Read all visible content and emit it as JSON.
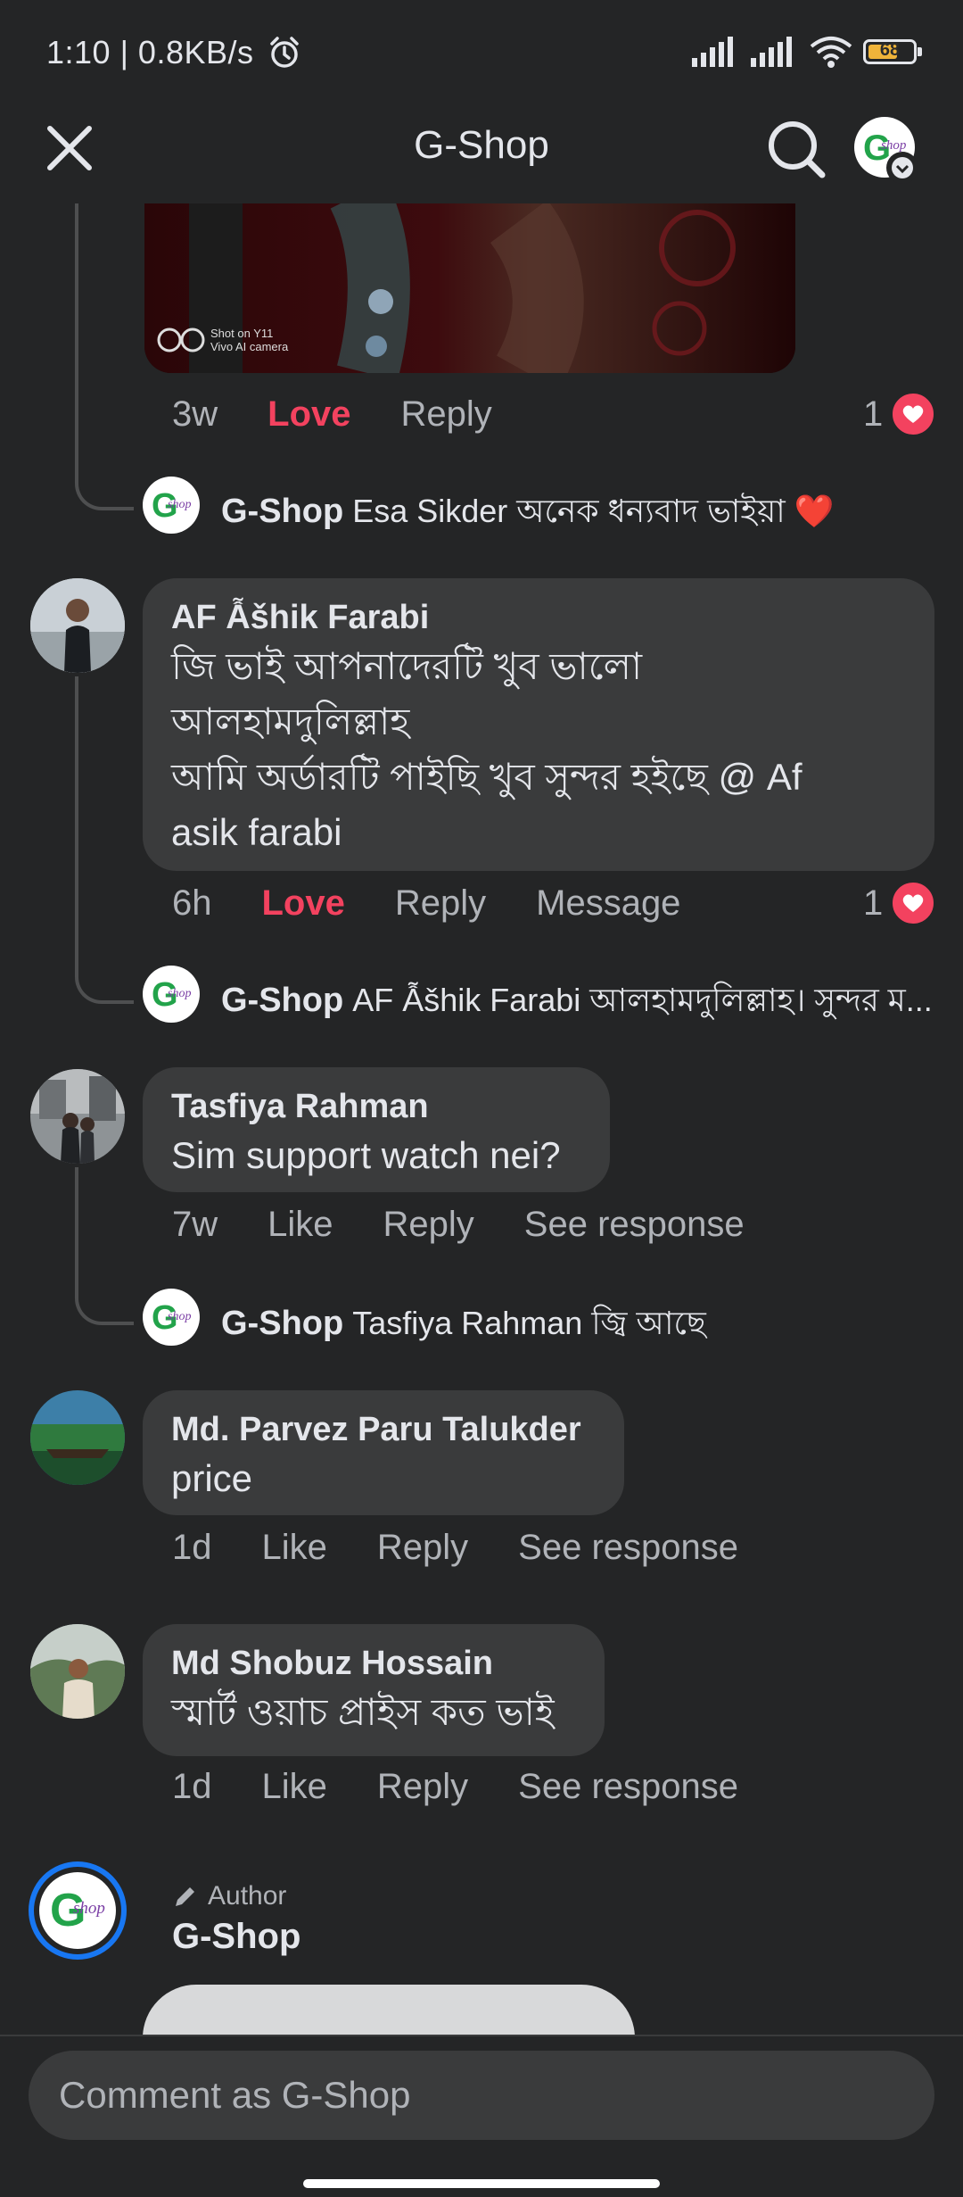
{
  "status_bar": {
    "time": "1:10 | 0.8KB/s",
    "battery": "68"
  },
  "app_bar": {
    "title": "G-Shop"
  },
  "photo_watermark": {
    "line1": "Shot on Y11",
    "line2": "Vivo AI camera"
  },
  "first_comment_actions": {
    "time": "3w",
    "love": "Love",
    "reply": "Reply",
    "reaction_count": "1"
  },
  "reply1": {
    "author": "G-Shop",
    "text": "Esa Sikder অনেক ধন্যবাদ ভাইয়া ❤️"
  },
  "comments": [
    {
      "author": "AF Ẫšhik Farabi",
      "lines": [
        "জি ভাই আপনাদেরটি খুব ভালো",
        "আলহামদুলিল্লাহ",
        "আমি অর্ডারটি পাইছি খুব সুন্দর হইছে @ Af",
        "asik farabi"
      ],
      "time": "6h",
      "action1": "Love",
      "reply": "Reply",
      "extra": "Message",
      "reaction_count": "1",
      "page_reply": {
        "author": "G-Shop",
        "text": "AF Ẫšhik Farabi আলহামদুলিল্লাহ। সুন্দর ম..."
      }
    },
    {
      "author": "Tasfiya Rahman",
      "text": "Sim support watch nei?",
      "time": "7w",
      "action1": "Like",
      "reply": "Reply",
      "extra": "See response",
      "page_reply": {
        "author": "G-Shop",
        "text": "Tasfiya Rahman জ্বি আছে"
      }
    },
    {
      "author": "Md. Parvez Paru Talukder",
      "text": "price",
      "time": "1d",
      "action1": "Like",
      "reply": "Reply",
      "extra": "See response"
    },
    {
      "author": "Md Shobuz Hossain",
      "text": "স্মার্ট ওয়াচ প্রাইস কত ভাই",
      "time": "1d",
      "action1": "Like",
      "reply": "Reply",
      "extra": "See response"
    }
  ],
  "author_post": {
    "badge": "Author",
    "name": "G-Shop"
  },
  "composer": {
    "placeholder": "Comment as G-Shop"
  },
  "colors": {
    "background": "#242526",
    "bubble": "#3a3b3c",
    "love": "#f3425f",
    "secondary_text": "#b0b3b8",
    "author_ring": "#1877f2"
  },
  "icons": [
    "close-icon",
    "search-icon",
    "alarm-icon",
    "signal-icon",
    "wifi-icon",
    "battery-icon",
    "heart-icon",
    "pencil-icon"
  ]
}
